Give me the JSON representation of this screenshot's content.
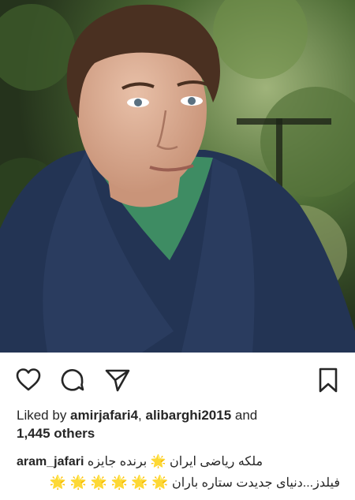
{
  "post": {
    "image_alt": "portrait photo",
    "likes": {
      "prefix": "Liked by ",
      "user1": "amirjafari4",
      "sep": ", ",
      "user2": "alibarghi2015",
      "and": " and",
      "others": "1,445 others"
    },
    "caption": {
      "username": "aram_jafari",
      "line1": "ملکه ریاضی ایران 🌟 برنده جایزه",
      "line2": "فیلدز...دنیای جدیدت ستاره باران",
      "stars": "🌟 🌟 🌟 🌟 🌟 🌟"
    }
  },
  "icons": {
    "like": "heart-icon",
    "comment": "comment-bubble-icon",
    "share": "paper-plane-icon",
    "save": "bookmark-icon"
  }
}
